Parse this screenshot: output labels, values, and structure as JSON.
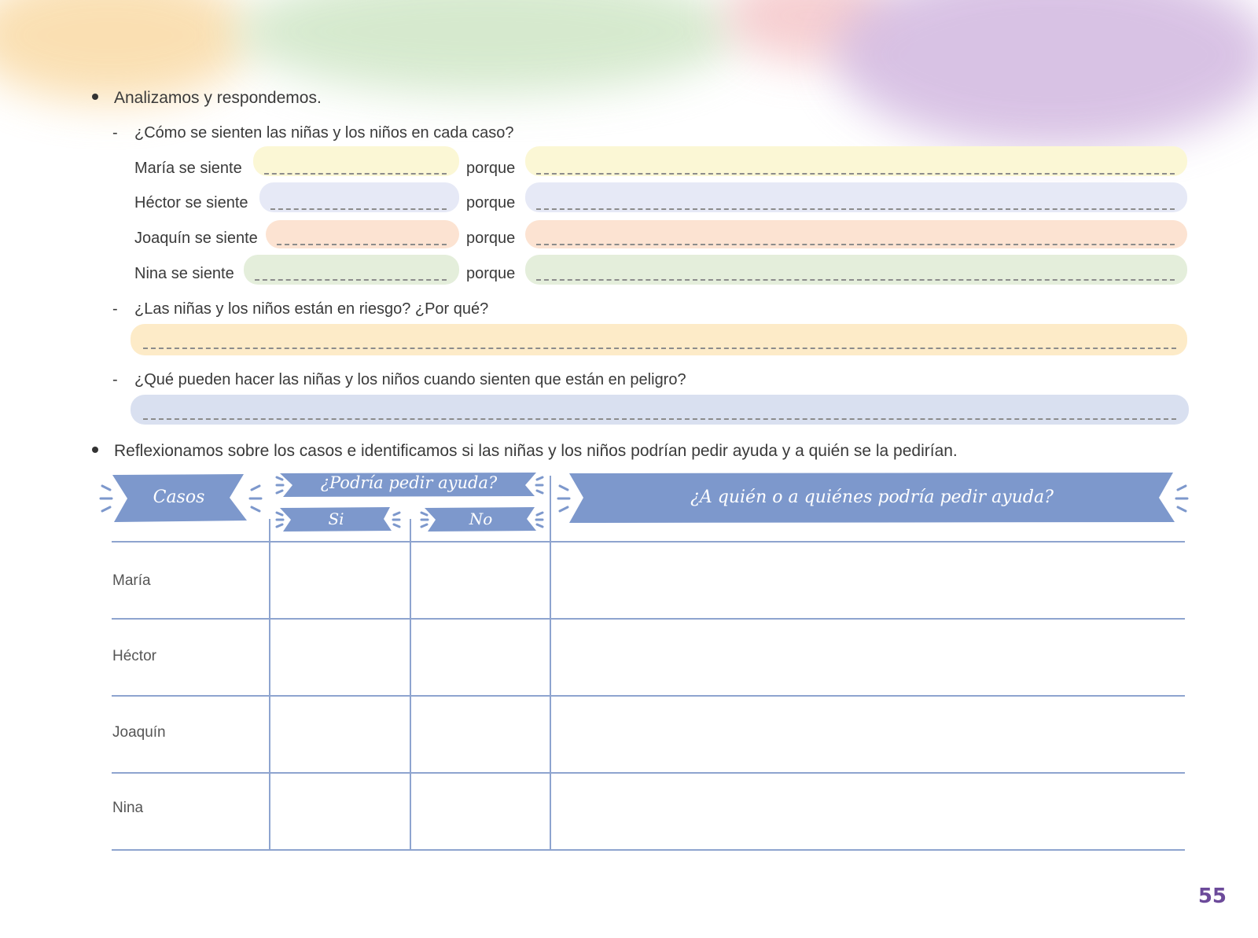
{
  "instructions": {
    "analyze": "Analizamos y respondemos.",
    "question1": "¿Cómo se sienten las niñas y los niños en cada caso?",
    "question2": "¿Las niñas y los niños están en riesgo? ¿Por qué?",
    "question3": "¿Qué pueden hacer las niñas y los niños cuando sienten que están en peligro?",
    "reflect": "Reflexionamos sobre los casos e identificamos si las niñas y los niños podrían pedir ayuda y a quién se la pedirían."
  },
  "feelings": [
    {
      "label": "María se siente",
      "porque": "porque",
      "color": "#fbf7d5"
    },
    {
      "label": "Héctor se siente",
      "porque": "porque",
      "color": "#e6e9f6"
    },
    {
      "label": "Joaquín se siente",
      "porque": "porque",
      "color": "#fce3d2"
    },
    {
      "label": "Nina se siente",
      "porque": "porque",
      "color": "#e4eedb"
    }
  ],
  "answer_colors": {
    "risk": "#fdebc8",
    "danger": "#d9e0f0"
  },
  "table": {
    "header_cases": "Casos",
    "header_help": "¿Podría pedir ayuda?",
    "header_si": "Si",
    "header_no": "No",
    "header_whom": "¿A quién o a quiénes podría pedir ayuda?",
    "rows": [
      "María",
      "Héctor",
      "Joaquín",
      "Nina"
    ],
    "accent": "#7d98cc"
  },
  "page_number": "55"
}
